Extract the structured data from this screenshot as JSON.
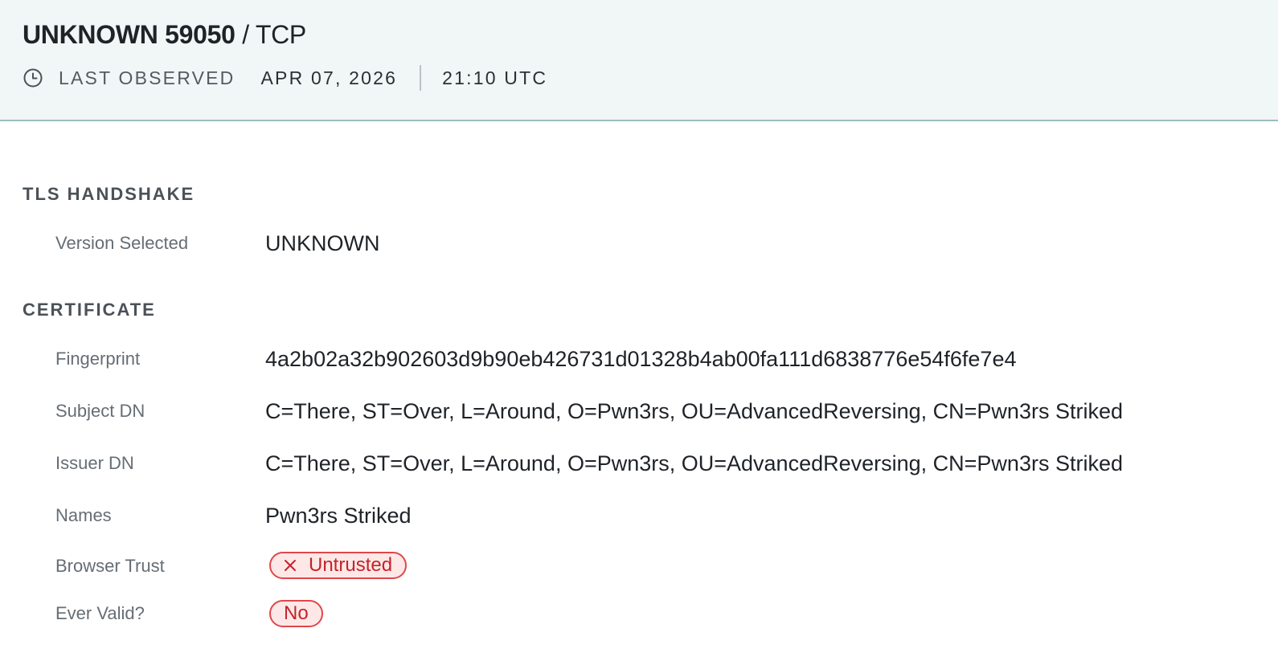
{
  "header": {
    "service": "UNKNOWN 59050",
    "separator": "/",
    "protocol": "TCP",
    "observed_label": "LAST OBSERVED",
    "observed_date": "APR 07, 2026",
    "observed_time": "21:10 UTC",
    "observed_icon": "clock-icon"
  },
  "tls": {
    "section_title": "TLS HANDSHAKE",
    "version_label": "Version Selected",
    "version_value": "UNKNOWN"
  },
  "certificate": {
    "section_title": "CERTIFICATE",
    "fingerprint_label": "Fingerprint",
    "fingerprint_value": "4a2b02a32b902603d9b90eb426731d01328b4ab00fa111d6838776e54f6fe7e4",
    "subject_label": "Subject DN",
    "subject_value": "C=There, ST=Over, L=Around, O=Pwn3rs, OU=AdvancedReversing, CN=Pwn3rs Striked",
    "issuer_label": "Issuer DN",
    "issuer_value": "C=There, ST=Over, L=Around, O=Pwn3rs, OU=AdvancedReversing, CN=Pwn3rs Striked",
    "names_label": "Names",
    "names_value": "Pwn3rs Striked",
    "trust_label": "Browser Trust",
    "trust_value": "Untrusted",
    "trust_icon": "x-icon",
    "valid_label": "Ever Valid?",
    "valid_value": "No"
  },
  "colors": {
    "header_bg": "#f1f6f6",
    "header_border": "#9cbdbe",
    "danger": "#c4242a",
    "danger_bg": "#fde8e7"
  }
}
